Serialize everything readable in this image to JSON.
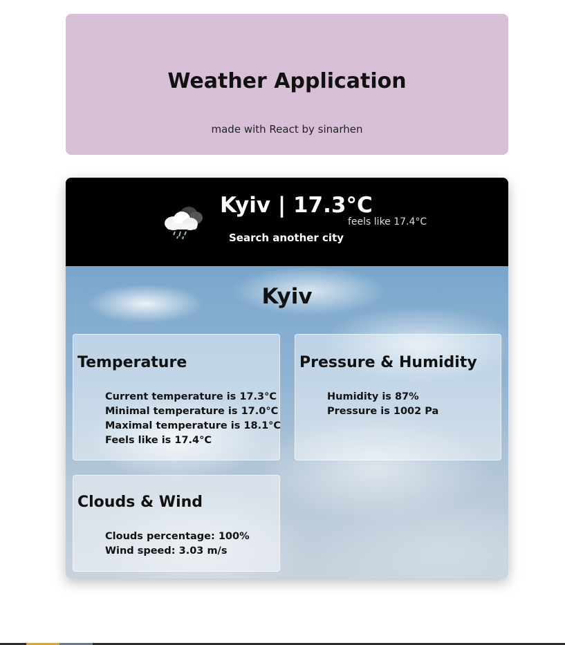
{
  "header": {
    "title": "Weather Application",
    "subtitle": "made with React by sinarhen"
  },
  "current": {
    "icon": "rain-cloud-icon",
    "city_temp": "Kyiv | 17.3°C",
    "feels_like": "feels like 17.4°C",
    "search_label": "Search another city"
  },
  "details": {
    "city": "Kyiv",
    "temperature": {
      "title": "Temperature",
      "items": [
        "Current temperature is 17.3°C",
        "Minimal temperature is 17.0°C",
        "Maximal temperature is 18.1°C",
        "Feels like is 17.4°C"
      ]
    },
    "pressure_humidity": {
      "title": "Pressure & Humidity",
      "items": [
        "Humidity is 87%",
        "Pressure is 1002 Pa"
      ]
    },
    "clouds_wind": {
      "title": "Clouds & Wind",
      "items": [
        "Clouds percentage: 100%",
        "Wind speed: 3.03 m/s"
      ]
    }
  },
  "colors": {
    "header_bg": "#d8bfd8",
    "top_bar_bg": "#000000"
  }
}
